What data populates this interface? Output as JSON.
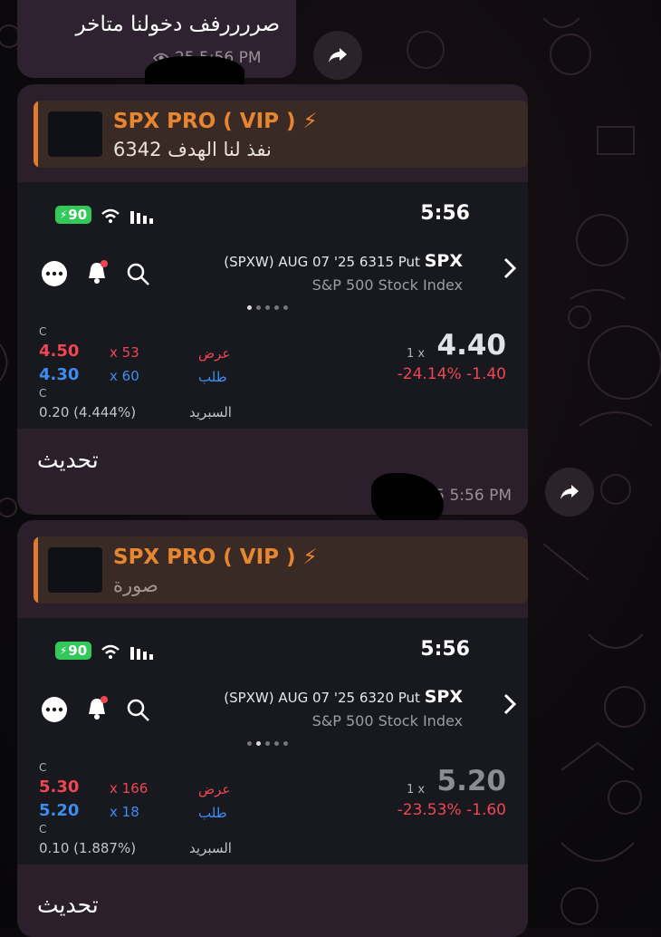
{
  "top_message": {
    "text": "صررررفف دخولنا متاخر",
    "time": "25 5:56 PM"
  },
  "messages": [
    {
      "reply": {
        "name": "SPX PRO ( VIP ) ⚡",
        "text": "نفذ لنا الهدف 6342"
      },
      "screenshot": {
        "battery": "90",
        "clock": "5:56",
        "symbol": "SPX",
        "contract": "(SPXW) AUG 07 '25 6315 Put",
        "index_name": "S&P 500 Stock Index",
        "c_label": "C",
        "ask_price": "4.50",
        "ask_qty": "x 53",
        "ask_label": "عرض",
        "bid_price": "4.30",
        "bid_qty": "x 60",
        "bid_label": "طلب",
        "spread_value": "0.20 (4.444%)",
        "spread_label": "السبريد",
        "last_qty": "1 x",
        "last_price": "4.40",
        "change": "-24.14%  -1.40",
        "active_dot": 0
      },
      "caption": "تحديث",
      "time": "25 5:56 PM"
    },
    {
      "reply": {
        "name": "SPX PRO ( VIP ) ⚡",
        "text": "صورة"
      },
      "screenshot": {
        "battery": "90",
        "clock": "5:56",
        "symbol": "SPX",
        "contract": "(SPXW) AUG 07 '25 6320 Put",
        "index_name": "S&P 500 Stock Index",
        "c_label": "C",
        "ask_price": "5.30",
        "ask_qty": "x 166",
        "ask_label": "عرض",
        "bid_price": "5.20",
        "bid_qty": "x 18",
        "bid_label": "طلب",
        "spread_value": "0.10 (1.887%)",
        "spread_label": "السبريد",
        "last_qty": "1 x",
        "last_price": "5.20",
        "change": "-23.53%  -1.60",
        "active_dot": 1
      },
      "caption": "تحديث"
    }
  ],
  "icons": [
    "forward-icon",
    "more-icon",
    "bell-icon",
    "search-icon",
    "wifi-icon",
    "signal-icon",
    "chevron-right-icon",
    "eye-icon"
  ],
  "colors": {
    "brand_orange": "#e8852f",
    "ask_red": "#f04552",
    "bid_blue": "#3f8cf0",
    "battery_green": "#33c85a"
  }
}
